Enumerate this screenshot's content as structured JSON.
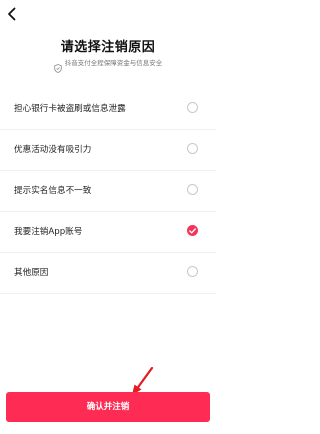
{
  "header": {
    "back_icon": "chevron-left-icon",
    "title": "请选择注销原因",
    "subtitle": "抖音支付全程保障资金与信息安全",
    "subtitle_icon": "shield-icon"
  },
  "options": [
    {
      "label": "担心银行卡被盗刷或信息泄露",
      "checked": false
    },
    {
      "label": "优惠活动没有吸引力",
      "checked": false
    },
    {
      "label": "提示实名信息不一致",
      "checked": false
    },
    {
      "label": "我要注销App账号",
      "checked": true
    },
    {
      "label": "其他原因",
      "checked": false
    }
  ],
  "confirm_button": {
    "label": "确认并注销"
  },
  "colors": {
    "accent": "#fe2c55",
    "radio_checked": "#f2355a",
    "radio_unchecked_border": "#c9c9c9"
  }
}
